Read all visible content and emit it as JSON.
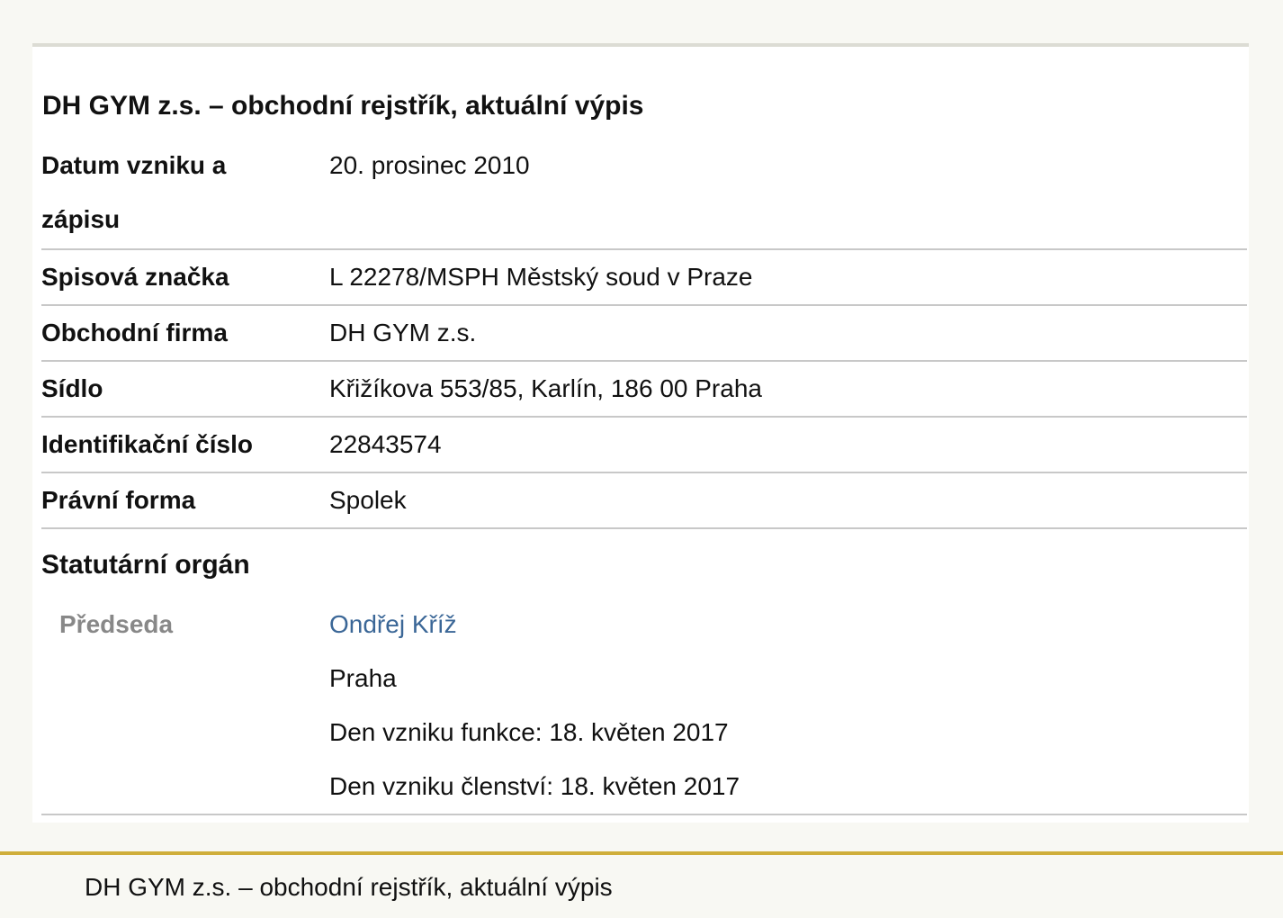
{
  "page": {
    "title": "DH GYM z.s. – obchodní rejstřík, aktuální výpis"
  },
  "rows": [
    {
      "label": "Datum vzniku a zápisu",
      "value": "20. prosinec 2010"
    },
    {
      "label": "Spisová značka",
      "value": "L 22278/MSPH Městský soud v Praze"
    },
    {
      "label": "Obchodní firma",
      "value": "DH GYM z.s."
    },
    {
      "label": "Sídlo",
      "value": "Křižíkova 553/85, Karlín, 186 00 Praha"
    },
    {
      "label": "Identifikační číslo",
      "value": "22843574"
    },
    {
      "label": "Právní forma",
      "value": "Spolek"
    }
  ],
  "statutory": {
    "title": "Statutární orgán",
    "role": "Předseda",
    "name": "Ondřej Kříž",
    "city": "Praha",
    "function_start": "Den vzniku funkce: 18. květen 2017",
    "membership_start": "Den vzniku členství: 18. květen 2017"
  },
  "footer": {
    "text": "DH GYM z.s. – obchodní rejstřík, aktuální výpis"
  },
  "colors": {
    "link": "#3b6797",
    "footer_accent": "#cfae3a",
    "muted_label": "#888888"
  }
}
